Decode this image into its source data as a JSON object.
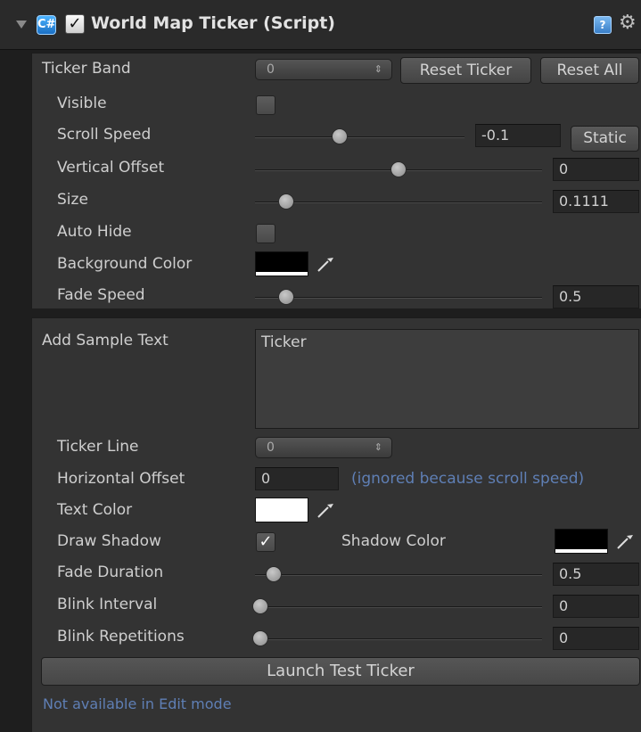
{
  "header": {
    "title": "World Map Ticker (Script)",
    "script_icon": "script-icon",
    "enabled": true,
    "help_icon": "help-icon",
    "settings_icon": "gear-icon",
    "script_icon_glyph": "C#",
    "help_icon_glyph": "?"
  },
  "ticker_band": {
    "label": "Ticker Band",
    "value": "0",
    "reset_ticker_label": "Reset Ticker",
    "reset_all_label": "Reset All"
  },
  "band_settings": {
    "visible": {
      "label": "Visible",
      "checked": false
    },
    "scroll_speed": {
      "label": "Scroll Speed",
      "value": "-0.1",
      "static_label": "Static",
      "slider_fraction": 0.45
    },
    "vertical_offset": {
      "label": "Vertical Offset",
      "value": "0",
      "slider_fraction": 0.5
    },
    "size": {
      "label": "Size",
      "value": "0.1111",
      "slider_fraction": 0.11
    },
    "auto_hide": {
      "label": "Auto Hide",
      "checked": false
    },
    "background_color": {
      "label": "Background Color",
      "color": "#000000"
    },
    "fade_speed": {
      "label": "Fade Speed",
      "value": "0.5",
      "slider_fraction": 0.11
    }
  },
  "sample_text": {
    "label": "Add Sample Text",
    "value": "Ticker",
    "ticker_line": {
      "label": "Ticker Line",
      "value": "0"
    },
    "horizontal_offset": {
      "label": "Horizontal Offset",
      "value": "0",
      "note": "(ignored because scroll speed)"
    },
    "text_color": {
      "label": "Text Color",
      "color": "#ffffff"
    },
    "draw_shadow": {
      "label": "Draw Shadow",
      "checked": true
    },
    "shadow_color": {
      "label": "Shadow Color",
      "color": "#000000"
    },
    "fade_duration": {
      "label": "Fade Duration",
      "value": "0.5",
      "slider_fraction": 0.06
    },
    "blink_interval": {
      "label": "Blink Interval",
      "value": "0",
      "slider_fraction": 0.0
    },
    "blink_repetitions": {
      "label": "Blink Repetitions",
      "value": "0",
      "slider_fraction": 0.0
    },
    "launch_label": "Launch Test Ticker",
    "status": "Not available in Edit mode"
  },
  "colors": {
    "link_blue": "#5f7fb5",
    "panel_bg": "#333333"
  }
}
